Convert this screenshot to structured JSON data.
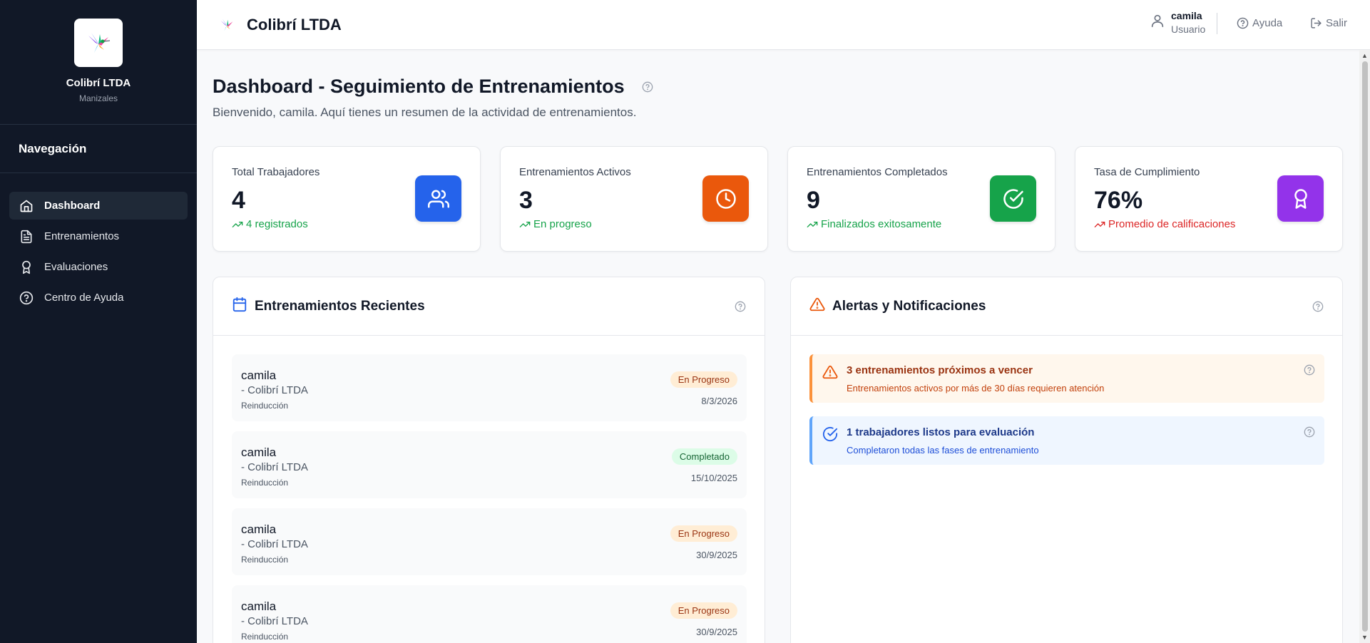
{
  "sidebar": {
    "company": "Colibrí LTDA",
    "city": "Manizales",
    "nav_heading": "Navegación",
    "items": [
      {
        "label": "Dashboard",
        "icon": "home-icon",
        "active": true
      },
      {
        "label": "Entrenamientos",
        "icon": "document-icon",
        "active": false
      },
      {
        "label": "Evaluaciones",
        "icon": "award-icon",
        "active": false
      },
      {
        "label": "Centro de Ayuda",
        "icon": "help-circle-icon",
        "active": false
      }
    ]
  },
  "header": {
    "title": "Colibrí LTDA",
    "user_name": "camila",
    "user_role": "Usuario",
    "help_label": "Ayuda",
    "logout_label": "Salir"
  },
  "page": {
    "title": "Dashboard - Seguimiento de Entrenamientos",
    "subtitle": "Bienvenido, camila. Aquí tienes un resumen de la actividad de entrenamientos."
  },
  "stats": [
    {
      "label": "Total Trabajadores",
      "value": "4",
      "trend": "4 registrados",
      "trend_color": "#16a34a",
      "icon": "users-icon",
      "color": "#2563eb"
    },
    {
      "label": "Entrenamientos Activos",
      "value": "3",
      "trend": "En progreso",
      "trend_color": "#16a34a",
      "icon": "clock-icon",
      "color": "#ea580c"
    },
    {
      "label": "Entrenamientos Completados",
      "value": "9",
      "trend": "Finalizados exitosamente",
      "trend_color": "#16a34a",
      "icon": "check-circle-icon",
      "color": "#16a34a"
    },
    {
      "label": "Tasa de Cumplimiento",
      "value": "76%",
      "trend": "Promedio de calificaciones",
      "trend_color": "#dc2626",
      "icon": "award-icon",
      "color": "#9333ea"
    }
  ],
  "recent": {
    "title": "Entrenamientos Recientes",
    "items": [
      {
        "name": "camila",
        "company": "- Colibrí LTDA",
        "type": "Reinducción",
        "status": "En Progreso",
        "date": "8/3/2026"
      },
      {
        "name": "camila",
        "company": "- Colibrí LTDA",
        "type": "Reinducción",
        "status": "Completado",
        "date": "15/10/2025"
      },
      {
        "name": "camila",
        "company": "- Colibrí LTDA",
        "type": "Reinducción",
        "status": "En Progreso",
        "date": "30/9/2025"
      },
      {
        "name": "camila",
        "company": "- Colibrí LTDA",
        "type": "Reinducción",
        "status": "En Progreso",
        "date": "30/9/2025"
      }
    ]
  },
  "alerts": {
    "title": "Alertas y Notificaciones",
    "items": [
      {
        "title": "3 entrenamientos próximos a vencer",
        "text": "Entrenamientos activos por más de 30 días requieren atención",
        "kind": "warning",
        "title_color": "#9a3412",
        "text_color": "#c2410c"
      },
      {
        "title": "1 trabajadores listos para evaluación",
        "text": "Completaron todas las fases de entrenamiento",
        "kind": "info",
        "title_color": "#1e3a8a",
        "text_color": "#1d4ed8"
      }
    ]
  }
}
